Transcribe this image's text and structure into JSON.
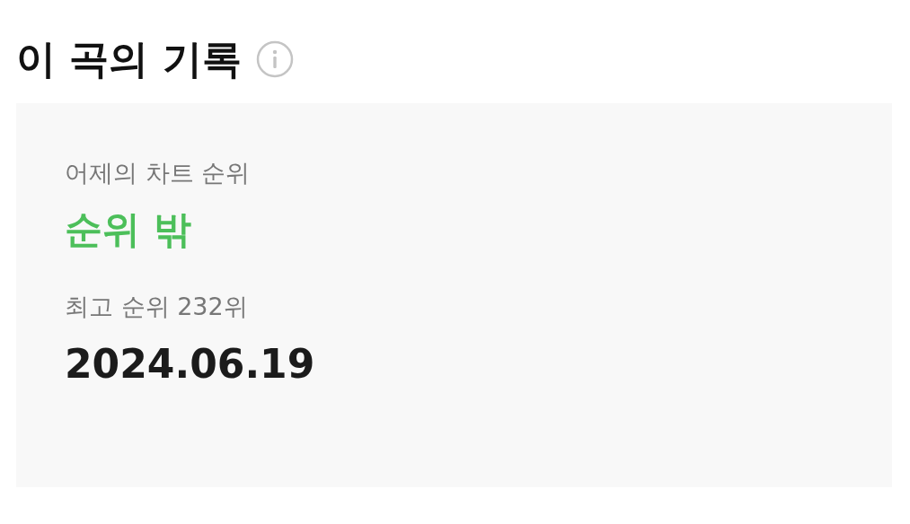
{
  "section": {
    "title": "이 곡의 기록"
  },
  "record": {
    "yesterday_label": "어제의 차트 순위",
    "yesterday_value": "순위 밖",
    "best_label": "최고 순위 232위",
    "best_date": "2024.06.19"
  }
}
